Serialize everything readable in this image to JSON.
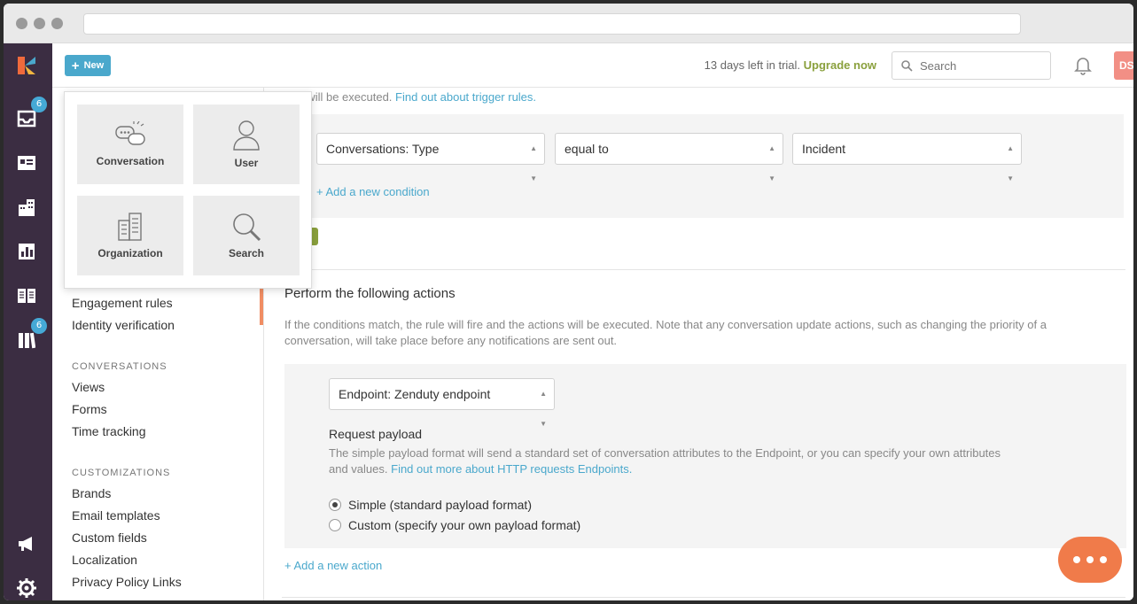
{
  "browser": {
    "url": ""
  },
  "rail": {
    "inbox_badge": "6",
    "library_badge": "6"
  },
  "topbar": {
    "new_label": "New",
    "trial_text": "13 days left in trial.",
    "upgrade_label": "Upgrade now",
    "search_placeholder": "Search",
    "avatar_initials": "DS"
  },
  "new_menu": {
    "items": [
      {
        "label": "Conversation",
        "icon": "conversation-icon"
      },
      {
        "label": "User",
        "icon": "user-icon"
      },
      {
        "label": "Organization",
        "icon": "organization-icon"
      },
      {
        "label": "Search",
        "icon": "search-icon"
      }
    ]
  },
  "sidebar": {
    "top_links": [
      "Engagement rules",
      "Identity verification"
    ],
    "conversations_heading": "CONVERSATIONS",
    "conversations_links": [
      "Views",
      "Forms",
      "Time tracking"
    ],
    "customizations_heading": "CUSTOMIZATIONS",
    "customizations_links": [
      "Brands",
      "Email templates",
      "Custom fields",
      "Localization",
      "Privacy Policy Links"
    ]
  },
  "main": {
    "top_note": "age will be executed.",
    "top_note_link": "Find out about trigger rules.",
    "condition": {
      "field": "Conversations: Type",
      "operator": "equal to",
      "value": "Incident",
      "add_label": "+ Add a new condition"
    },
    "actions_heading": "Perform the following actions",
    "actions_note": "If the conditions match, the rule will fire and the actions will be executed. Note that any conversation update actions, such as changing the priority of a conversation, will take place before any notifications are sent out.",
    "endpoint_select": "Endpoint: Zenduty endpoint",
    "payload_heading": "Request payload",
    "payload_note": "The simple payload format will send a standard set of conversation attributes to the Endpoint, or you can specify your own attributes and values.",
    "payload_link": "Find out more about HTTP requests Endpoints.",
    "radio_simple": "Simple (standard payload format)",
    "radio_custom": "Custom (specify your own payload format)",
    "selected_payload": "simple",
    "add_action_label": "+ Add a new action"
  },
  "colors": {
    "rail": "#3b2d42",
    "accent": "#4aa8cc",
    "upgrade": "#8aa03d",
    "chat": "#f07b4a"
  }
}
